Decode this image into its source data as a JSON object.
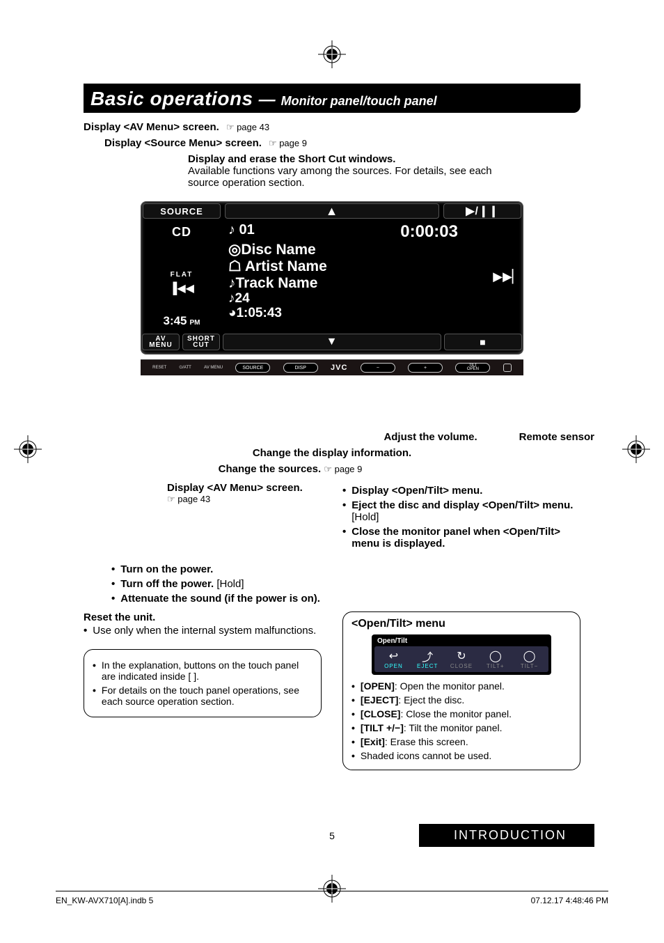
{
  "title": {
    "main": "Basic operations",
    "dash": "—",
    "sub": "Monitor panel/touch panel"
  },
  "callouts": {
    "avmenu": {
      "label": "Display <AV Menu> screen.",
      "ref": "☞ page 43"
    },
    "srcmenu": {
      "label": "Display <Source Menu> screen.",
      "ref": "☞ page 9"
    },
    "shortcut": {
      "label": "Display and erase the Short Cut windows.",
      "desc": "Available functions vary among the sources. For details, see each source operation section."
    }
  },
  "display": {
    "top": {
      "source": "SOURCE",
      "up": "▲",
      "playpause": "▶/❙❙"
    },
    "left": {
      "src": "CD",
      "eq": "FLAT",
      "prev": "▐◀◀",
      "clock": "3:45",
      "ampm": "PM"
    },
    "center": {
      "track_no": "♪ 01",
      "time": "0:00:03",
      "disc": "◎Disc Name",
      "artist": "☖ Artist Name",
      "track": "♪Track Name",
      "count": "♪24",
      "total": "◕1:05:43"
    },
    "right": {
      "next": "▶▶▏"
    },
    "bottom": {
      "avmenu_top": "AV",
      "avmenu_bot": "MENU",
      "short_top": "SHORT",
      "short_bot": "CUT",
      "down": "▼",
      "stop": "■"
    },
    "hw": {
      "reset": "RESET",
      "att": "⏻/ATT",
      "avmenu": "AV MENU",
      "source_btn": "SOURCE",
      "disp_btn": "DISP",
      "brand": "JVC",
      "minus": "−",
      "plus": "+",
      "tilt_top": "TILT",
      "tilt_bot": "OPEN"
    }
  },
  "lower": {
    "vol": "Adjust the volume.",
    "remote": "Remote sensor",
    "dispinfo": "Change the display information.",
    "chgsrc": "Change the sources.",
    "chgsrc_ref": "☞ page 9",
    "avmenu2": "Display <AV Menu> screen.",
    "avmenu2_ref": "☞ page 43",
    "power": [
      {
        "b": "Turn on the power.",
        "r": ""
      },
      {
        "b": "Turn off the power.",
        "r": " [Hold]"
      },
      {
        "b": "Attenuate the sound (if the power is on).",
        "r": ""
      }
    ],
    "reset": {
      "head": "Reset the unit.",
      "desc": "Use only when the internal system malfunctions."
    },
    "notes": [
      "In the explanation, buttons on the touch panel are indicated inside [       ].",
      "For details on the touch panel operations, see each source operation section."
    ],
    "opentilt_list": [
      {
        "b": "Display <Open/Tilt> menu.",
        "r": ""
      },
      {
        "b": "Eject the disc and display <Open/Tilt> menu.",
        "r": " [Hold]"
      },
      {
        "b": "Close the monitor panel when <Open/Tilt> menu is displayed.",
        "r": ""
      }
    ],
    "ot": {
      "head": "<Open/Tilt> menu",
      "title": "Open/Tilt",
      "icons": [
        {
          "lbl": "OPEN",
          "g": "↩",
          "cls": "cyan"
        },
        {
          "lbl": "EJECT",
          "g": "⤴",
          "cls": "cyan"
        },
        {
          "lbl": "CLOSE",
          "g": "↻",
          "cls": "grey"
        },
        {
          "lbl": "TILT+",
          "g": "◯",
          "cls": "grey"
        },
        {
          "lbl": "TILT−",
          "g": "◯",
          "cls": "grey"
        }
      ],
      "defs": [
        {
          "b": "[OPEN]",
          "r": ": Open the monitor panel."
        },
        {
          "b": "[EJECT]",
          "r": ": Eject the disc."
        },
        {
          "b": "[CLOSE]",
          "r": ": Close the monitor panel."
        },
        {
          "b": "[TILT +/−]",
          "r": ": Tilt the monitor panel."
        },
        {
          "b": "[Exit]",
          "r": ": Erase this screen."
        },
        {
          "b": "",
          "r": "Shaded icons cannot be used."
        }
      ]
    }
  },
  "page_num": "5",
  "section": "INTRODUCTION",
  "footer": {
    "left": "EN_KW-AVX710[A].indb   5",
    "right": "07.12.17   4:48:46 PM"
  }
}
